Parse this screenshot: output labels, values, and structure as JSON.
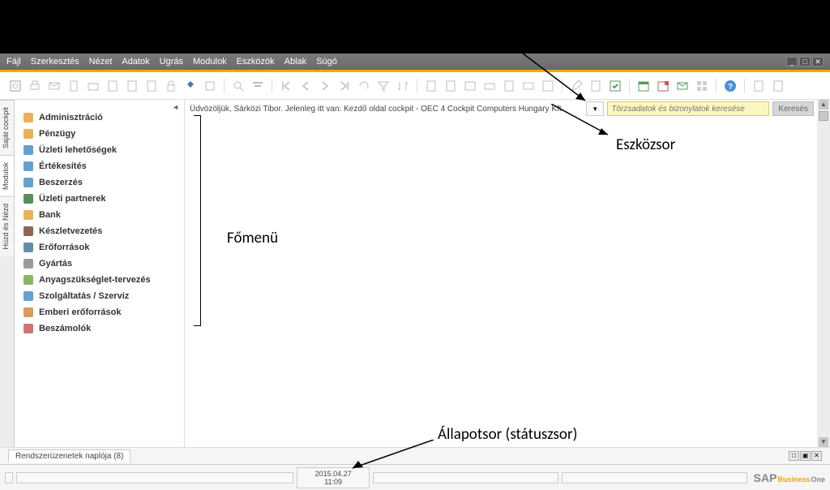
{
  "menubar": {
    "items": [
      "Fájl",
      "Szerkesztés",
      "Nézet",
      "Adatok",
      "Ugrás",
      "Modulok",
      "Eszközök",
      "Ablak",
      "Súgó"
    ]
  },
  "welcome": "Üdvözöljük, Sárközi Tibor. Jelenleg itt van: Kezdő oldal cockpit - OEC 4 Cockpit Computers Hungary Kft.",
  "search": {
    "placeholder": "Törzsadatok és bizonylatok keresése",
    "button": "Keresés"
  },
  "side_tabs": [
    "Saját cockpit",
    "Modulok",
    "Húzd és Nézd"
  ],
  "modules": [
    {
      "label": "Adminisztráció",
      "color": "#e8a33d"
    },
    {
      "label": "Pénzügy",
      "color": "#e8a33d"
    },
    {
      "label": "Üzleti lehetőségek",
      "color": "#4a90c8"
    },
    {
      "label": "Értékesítés",
      "color": "#4a90c8"
    },
    {
      "label": "Beszerzés",
      "color": "#4a90c8"
    },
    {
      "label": "Üzleti partnerek",
      "color": "#3b7a3b"
    },
    {
      "label": "Bank",
      "color": "#e8a33d"
    },
    {
      "label": "Készletvezetés",
      "color": "#7a4a3b"
    },
    {
      "label": "Erőforrások",
      "color": "#4a7a9a"
    },
    {
      "label": "Gyártás",
      "color": "#888"
    },
    {
      "label": "Anyagszükséglet-tervezés",
      "color": "#7aa84a"
    },
    {
      "label": "Szolgáltatás / Szerviz",
      "color": "#4a90c8"
    },
    {
      "label": "Emberi erőforrások",
      "color": "#d48a3d"
    },
    {
      "label": "Beszámolók",
      "color": "#c85a5a"
    }
  ],
  "syslog": {
    "label": "Rendszerüzenetek naplója (8)"
  },
  "status": {
    "date": "2015.04.27",
    "time": "11:09"
  },
  "brand": {
    "sap": "SAP",
    "biz": "Business",
    "one": "One"
  },
  "annotations": {
    "toolbar": "Eszközsor",
    "mainmenu": "Főmenü",
    "statusbar": "Állapotsor (státuszsor)"
  }
}
